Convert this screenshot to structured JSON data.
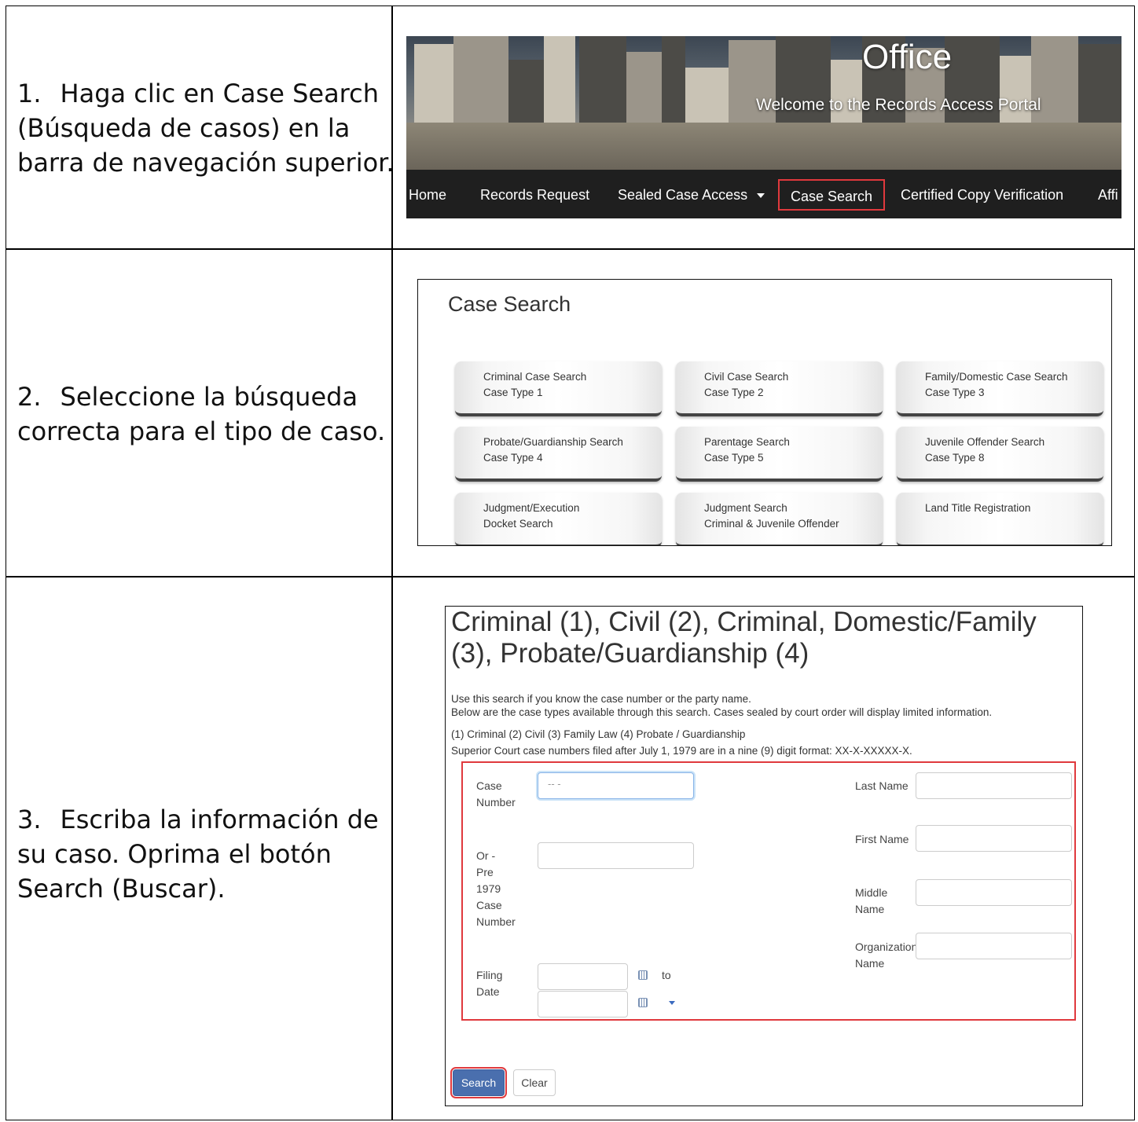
{
  "steps": [
    {
      "number": "1.",
      "text_lines": [
        "Haga clic en Case Search",
        "(Búsqueda de casos) en la",
        "barra de navegación superior."
      ]
    },
    {
      "number": "2.",
      "text_lines": [
        "Seleccione la búsqueda",
        "correcta para el tipo de caso."
      ]
    },
    {
      "number": "3.",
      "text_lines": [
        "Escriba la información de",
        "su caso. Oprima el botón",
        "Search (Buscar)."
      ]
    }
  ],
  "banner": {
    "title": "Office",
    "subtitle": "Welcome to the Records Access Portal",
    "nav": [
      "Home",
      "Records Request",
      "Sealed Case Access",
      "Case Search",
      "Certified Copy Verification",
      "Affi"
    ],
    "highlighted": "Case Search",
    "highlight_color": "#e0393d"
  },
  "case_search": {
    "title": "Case Search",
    "cards": [
      {
        "line1": "Criminal Case Search",
        "line2": "Case Type 1"
      },
      {
        "line1": "Civil Case Search",
        "line2": "Case Type 2"
      },
      {
        "line1": "Family/Domestic Case Search",
        "line2": "Case Type 3"
      },
      {
        "line1": "Probate/Guardianship Search",
        "line2": "Case Type 4"
      },
      {
        "line1": "Parentage Search",
        "line2": "Case Type 5"
      },
      {
        "line1": "Juvenile Offender Search",
        "line2": "Case Type 8"
      },
      {
        "line1": "Judgment/Execution",
        "line2": "Docket Search"
      },
      {
        "line1": "Judgment Search",
        "line2": "Criminal & Juvenile Offender"
      },
      {
        "line1": "Land Title Registration",
        "line2": ""
      }
    ]
  },
  "search_form": {
    "title": "Criminal (1), Civil (2), Criminal, Domestic/Family (3), Probate/Guardianship (4)",
    "desc1": "Use this search if you know the case number or the party name.",
    "desc2": "Below are the case types available through this search. Cases sealed by court order will display limited information.",
    "desc3": "(1) Criminal (2) Civil (3) Family Law (4) Probate / Guardianship",
    "desc4": "Superior Court case numbers filed after July 1, 1979 are in a nine (9) digit format: XX-X-XXXXX-X.",
    "case_number_label": "Case Number",
    "case_number_placeholder": "-- -",
    "pre1979_label": "Or - Pre 1979 Case Number",
    "filing_date_label": "Filing Date",
    "to_label": "to",
    "last_name_label": "Last Name",
    "first_name_label": "First Name",
    "middle_name_label": "Middle Name",
    "org_name_label": "Organization Name",
    "search_button": "Search",
    "clear_button": "Clear",
    "primary_color": "#4a6fae"
  }
}
